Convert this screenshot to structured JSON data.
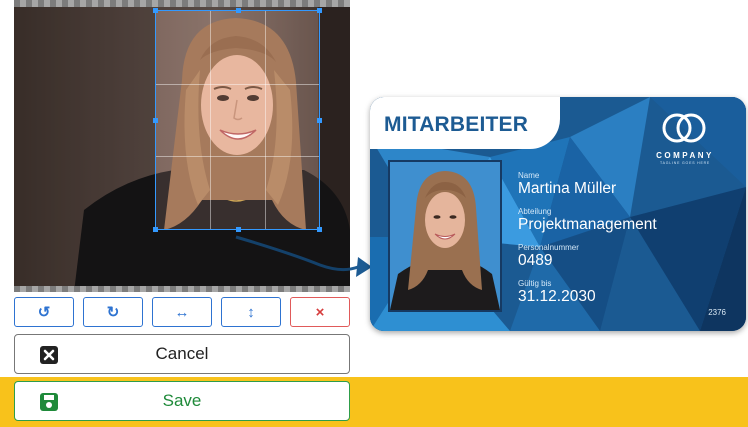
{
  "editor": {
    "toolbar": [
      {
        "name": "rotate-left-button",
        "icon": "rotate-left-icon",
        "glyph": "↺"
      },
      {
        "name": "rotate-right-button",
        "icon": "rotate-right-icon",
        "glyph": "↻"
      },
      {
        "name": "flip-horizontal-button",
        "icon": "arrows-horizontal-icon",
        "glyph": "↔"
      },
      {
        "name": "flip-vertical-button",
        "icon": "arrows-vertical-icon",
        "glyph": "↕"
      },
      {
        "name": "reset-button",
        "icon": "close-icon",
        "glyph": "×"
      }
    ],
    "cancel_label": "Cancel",
    "save_label": "Save"
  },
  "card": {
    "title": "MITARBEITER",
    "company": "COMPANY",
    "tagline": "TAGLINE GOES HERE",
    "fields": {
      "name_label": "Name",
      "name_value": "Martina Müller",
      "department_label": "Abteilung",
      "department_value": "Projektmanagement",
      "personnel_label": "Personalnummer",
      "personnel_value": "0489",
      "valid_label": "Gültig bis",
      "valid_value": "31.12.2030"
    },
    "number": "2376"
  },
  "colors": {
    "accent_blue": "#2e73d1",
    "danger_red": "#d63c3c",
    "save_green": "#1f8a3a",
    "band_yellow": "#f8c21b",
    "card_blue": "#1d5b93"
  }
}
